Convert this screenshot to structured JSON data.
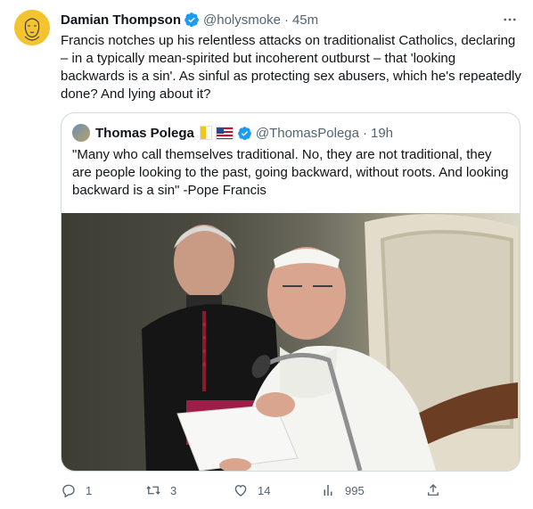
{
  "author": {
    "name": "Damian Thompson",
    "handle": "@holysmoke",
    "separator": "·",
    "time": "45m"
  },
  "tweet": {
    "text": "Francis notches up his relentless attacks on traditionalist Catholics, declaring – in a typically mean-spirited but incoherent outburst – that 'looking backwards is a sin'. As sinful as protecting sex abusers, which he's repeatedly done? And lying about it?"
  },
  "quoted": {
    "name": "Thomas Polega",
    "handle": "@ThomasPolega",
    "separator": "·",
    "time": "19h",
    "text": "\"Many who call themselves traditional. No, they are not traditional, they are people looking to the past, going backward, without roots. And looking backward is a sin\" -Pope Francis"
  },
  "metrics": {
    "replies": "1",
    "retweets": "3",
    "likes": "14",
    "views": "995"
  },
  "colors": {
    "accent": "#1d9bf0",
    "muted": "#536471",
    "border": "#cfd9de"
  },
  "icons": [
    "more-icon",
    "verified-icon",
    "reply-icon",
    "retweet-icon",
    "like-icon",
    "views-icon",
    "share-icon"
  ]
}
